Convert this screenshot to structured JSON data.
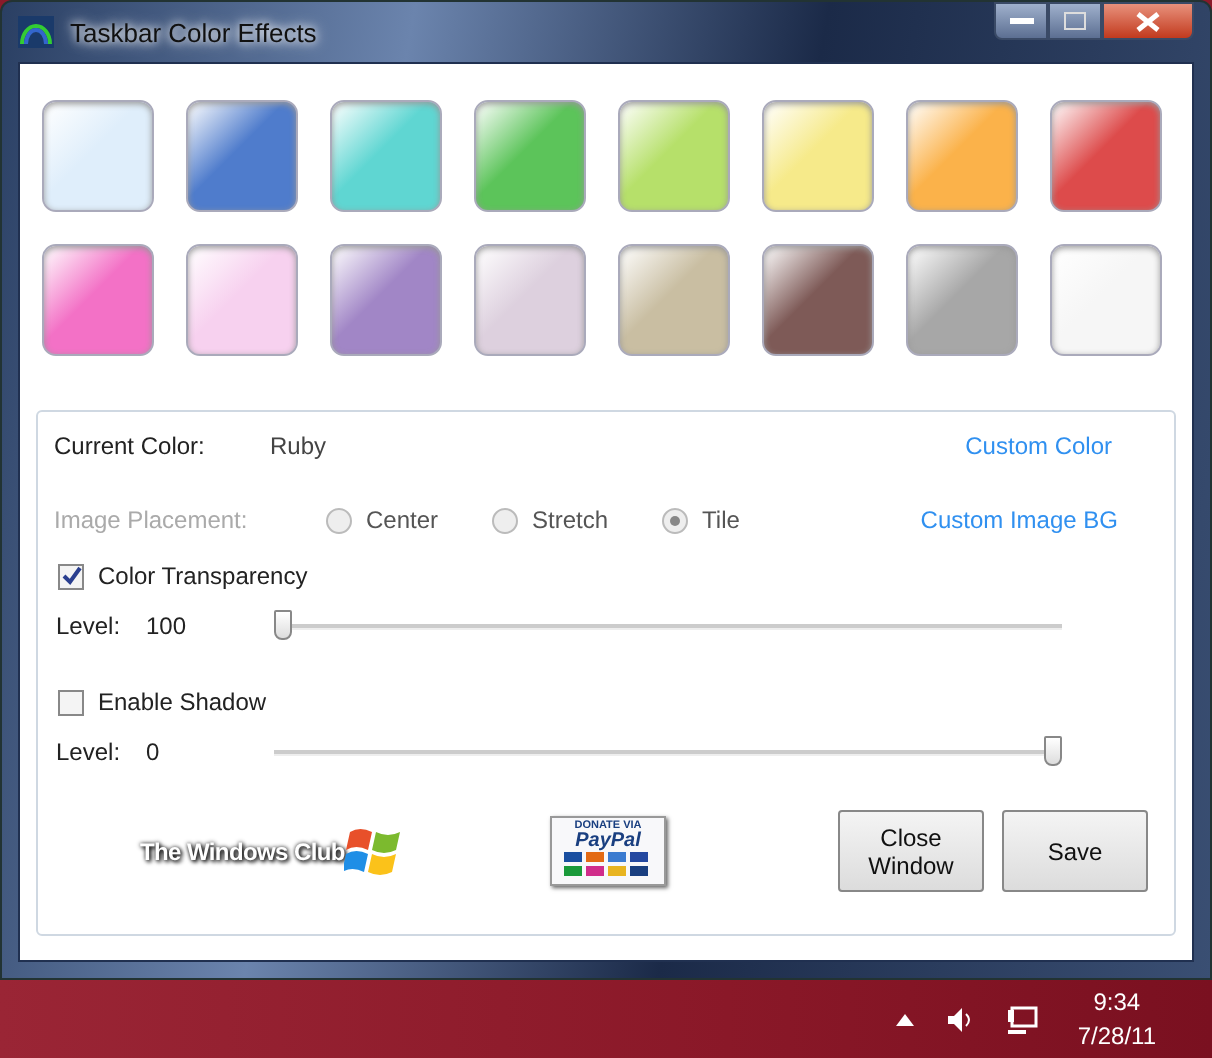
{
  "window": {
    "title": "Taskbar Color Effects"
  },
  "swatches": [
    {
      "color": "#dfeefb"
    },
    {
      "color": "#4f7ccc"
    },
    {
      "color": "#5fd6d2"
    },
    {
      "color": "#5cc45a"
    },
    {
      "color": "#b6e06a"
    },
    {
      "color": "#f6ea8a"
    },
    {
      "color": "#fbb24a"
    },
    {
      "color": "#dd4b4b"
    },
    {
      "color": "#f371c6"
    },
    {
      "color": "#f7d1ef"
    },
    {
      "color": "#a186c6"
    },
    {
      "color": "#ddd0de"
    },
    {
      "color": "#c9bea2"
    },
    {
      "color": "#7e5a57"
    },
    {
      "color": "#a7a7a7"
    },
    {
      "color": "#f6f6f6"
    }
  ],
  "current_color": {
    "label": "Current Color:",
    "value": "Ruby"
  },
  "custom_color_link": "Custom Color",
  "image_placement": {
    "label": "Image Placement:",
    "disabled": true,
    "options": [
      {
        "label": "Center",
        "selected": false
      },
      {
        "label": "Stretch",
        "selected": false
      },
      {
        "label": "Tile",
        "selected": true
      }
    ]
  },
  "custom_image_link": "Custom Image BG",
  "options": [
    {
      "label": "Color Transparency",
      "checked": true,
      "level_label": "Level:",
      "reading": "100",
      "level": 0
    },
    {
      "label": "Enable Shadow",
      "checked": false,
      "level_label": "Level:",
      "reading": "0",
      "level": 1
    }
  ],
  "logo": {
    "text": "The Windows Club"
  },
  "donate": {
    "top": "DONATE VIA",
    "brand": "PayPal"
  },
  "buttons": [
    {
      "label": "Close Window"
    },
    {
      "label": "Save"
    }
  ],
  "taskbar": {
    "time": "9:34",
    "date": "7/28/11"
  }
}
